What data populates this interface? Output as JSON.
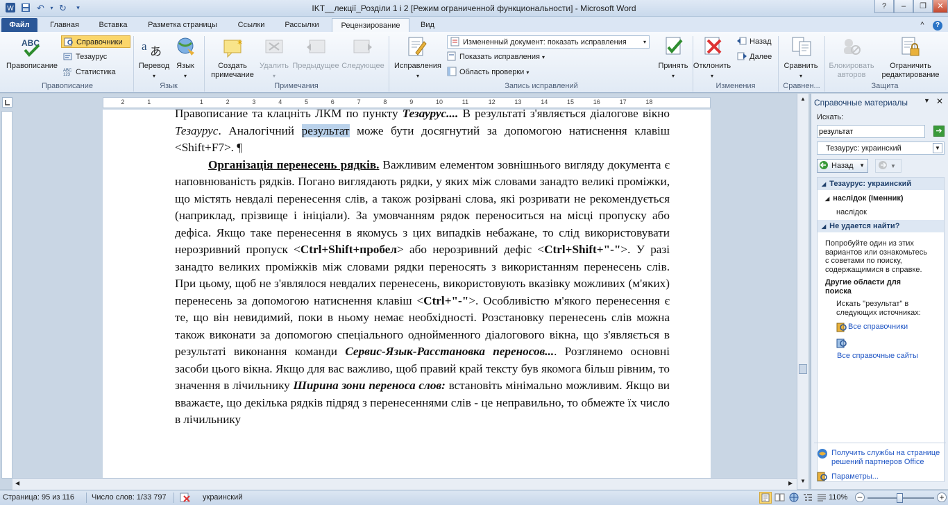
{
  "window": {
    "title": "IKT__лекції_Розділи 1 і 2 [Режим ограниченной функциональности]  -  Microsoft Word"
  },
  "tabs": [
    "Файл",
    "Главная",
    "Вставка",
    "Разметка страницы",
    "Ссылки",
    "Рассылки",
    "Рецензирование",
    "Вид"
  ],
  "ribbon": {
    "proofing": {
      "spelling": "Правописание",
      "research": "Справочники",
      "thesaurus": "Тезаурус",
      "wordcount": "Статистика",
      "group": "Правописание"
    },
    "language": {
      "translate": "Перевод",
      "language": "Язык",
      "group": "Язык"
    },
    "comments": {
      "new1": "Создать",
      "new2": "примечание",
      "delete": "Удалить",
      "prev": "Предыдущее",
      "next": "Следующее",
      "group": "Примечания"
    },
    "tracking": {
      "track": "Исправления",
      "display_mode": "Измененный документ: показать исправления",
      "show_markup": "Показать исправления",
      "review_pane": "Область проверки",
      "group": "Запись исправлений"
    },
    "changes": {
      "accept": "Принять",
      "reject": "Отклонить",
      "back": "Назад",
      "forward": "Далее",
      "group": "Изменения"
    },
    "compare": {
      "compare": "Сравнить",
      "group": "Сравнен..."
    },
    "protect": {
      "block1": "Блокировать",
      "block2": "авторов",
      "restrict1": "Ограничить",
      "restrict2": "редактирование",
      "group": "Защита"
    },
    "collapse_glyph": "^"
  },
  "ruler_numbers": [
    "2",
    "1",
    "1",
    "2",
    "3",
    "4",
    "5",
    "6",
    "7",
    "8",
    "9",
    "10",
    "11",
    "12",
    "13",
    "14",
    "15",
    "16",
    "17",
    "18"
  ],
  "document": {
    "p1a": "Правописание та клацніть ЛКМ по пункту ",
    "p1b": "Тезаурус....",
    "p1c": " В результаті з'являється діалогове вікно ",
    "p1d": "Тезаурус",
    "p1e": ". Аналогічний ",
    "p1f": "результат",
    "p1g": " може бути досягнутий за допомогою натиснення клавіш <Shift+F7>. ¶",
    "p2heading": "Організація перенесень рядків.",
    "p2a": " Важливим елементом зовнішнього вигляду документа є наповнюваність рядків. Погано виглядають рядки, у яких між словами занадто великі проміжки, що містять невдалі перенесення слів, а також розірвані слова, які розривати не рекомендується (наприклад, прізвище і ініціали). За умовчанням рядок переноситься на місці пропуску або дефіса. Якщо таке перенесення в якомусь з цих випадків небажане, то слід використовувати нерозривний пропуск <",
    "p2b": "Ctrl+Shift+пробел",
    "p2c": "> або нерозривний дефіс <",
    "p2d": "Ctrl+Shift+\"-\"",
    "p2e": ">. У разі занадто великих проміжків між словами рядки переносять з використанням перенесень слів. При цьому, щоб не з'являлося невдалих перенесень, використовують вказівку можливих (м'яких) перенесень за допомогою натиснення клавіш <",
    "p2f": "Ctrl+\"-\"",
    "p2g": ">. Особливістю м'якого перенесення є те, що він невидимий, поки в ньому немає необхідності. Розстановку перенесень слів можна також виконати за допомогою спеціального однойменного діалогового вікна, що з'являється в результаті виконання команди ",
    "p2h": "Сервис-Язык-Расстановка переносов...",
    "p2i": ". Розглянемо основні засоби цього вікна. Якщо для вас важливо, щоб правий край тексту був якомога більш рівним, то значення в лічильнику ",
    "p2j": "Ширина зони переноса слов:",
    "p2k": " встановіть мінімально можливим. Якщо ви вважаєте, що декілька рядків підряд з перенесеннями слів - це неправильно, то обмежте їх число в лічильнику"
  },
  "pane": {
    "title": "Справочные материалы",
    "search_label": "Искать:",
    "search_value": "результат",
    "source": "Тезаурус: украинский",
    "back": "Назад",
    "section1": "Тезаурус: украинский",
    "entry": "наслідок (Іменник)",
    "synonym": "наслідок",
    "section2": "Не удается найти?",
    "tip": [
      "Попробуйте один из этих",
      "вариантов или ознакомьтесь",
      "с советами по поиску,",
      "содержащимися в справке."
    ],
    "other": [
      "Другие области для",
      "поиска"
    ],
    "search_in": [
      "Искать \"результат\" в",
      "следующих источниках:"
    ],
    "all_books": "Все справочники",
    "all_sites": "Все справочные сайты",
    "services": [
      "Получить службы на странице",
      "решений партнеров Office"
    ],
    "params": "Параметры..."
  },
  "status": {
    "page": "Страница: 95 из 116",
    "words": "Число слов: 1/33 797",
    "lang": "украинский",
    "zoom": "110%"
  }
}
